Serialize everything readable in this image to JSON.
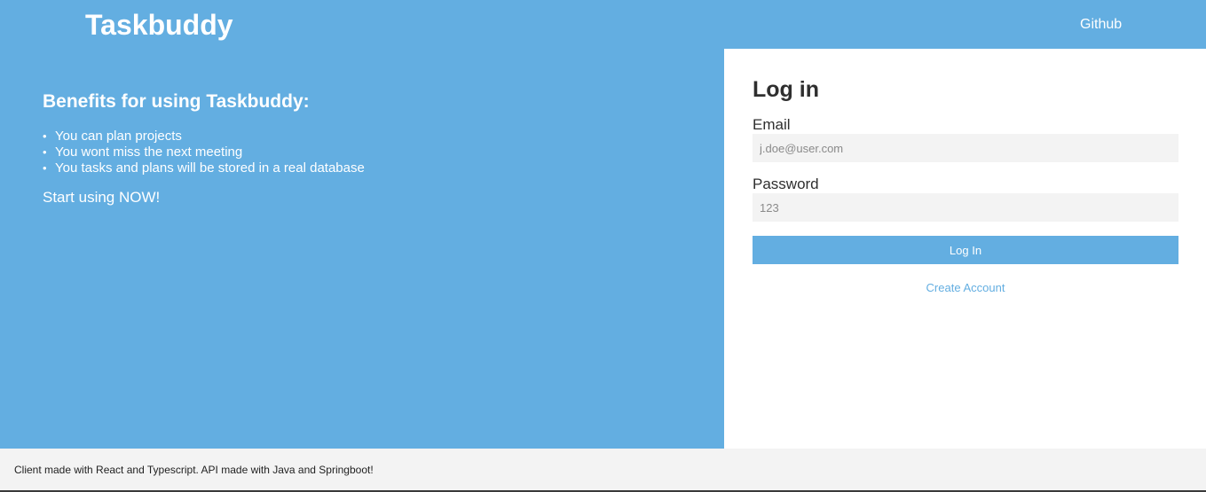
{
  "header": {
    "brand": "Taskbuddy",
    "github_link": "Github"
  },
  "info": {
    "heading": "Benefits for using Taskbuddy:",
    "benefits": [
      "You can plan projects",
      "You wont miss the next meeting",
      "You tasks and plans will be stored in a real database"
    ],
    "cta": "Start using NOW!"
  },
  "login": {
    "title": "Log in",
    "email_label": "Email",
    "email_value": "",
    "email_placeholder": "j.doe@user.com",
    "password_label": "Password",
    "password_value": "",
    "password_placeholder": "123",
    "submit_label": "Log In",
    "create_account_label": "Create Account"
  },
  "footer": {
    "text": "Client made with React and Typescript. API made with Java and Springboot!"
  },
  "colors": {
    "primary": "#63aee1",
    "panel_background": "#ffffff",
    "input_background": "#f3f3f3",
    "text_dark": "#2f2f2f"
  }
}
